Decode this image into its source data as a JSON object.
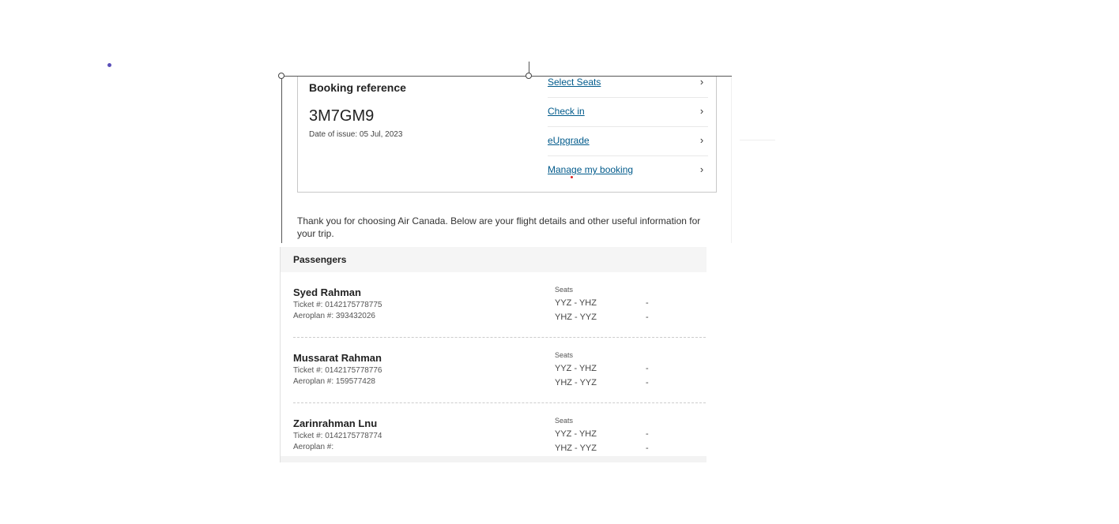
{
  "booking": {
    "label": "Booking reference",
    "code": "3M7GM9",
    "date_of_issue": "Date of issue: 05 Jul, 2023"
  },
  "links": [
    {
      "label": "Select Seats",
      "icon": "chevron-right-icon"
    },
    {
      "label": "Check in",
      "icon": "chevron-right-icon"
    },
    {
      "label": "eUpgrade",
      "icon": "chevron-right-icon"
    },
    {
      "label": "Manage my booking",
      "icon": "chevron-right-icon"
    }
  ],
  "intro_text": "Thank you for choosing Air Canada. Below are your flight details and other useful information for your trip.",
  "passengers_section": {
    "title": "Passengers",
    "seats_label": "Seats",
    "passengers": [
      {
        "name": "Syed Rahman",
        "ticket": "Ticket #: 0142175778775",
        "aeroplan": "Aeroplan #: 393432026",
        "seats": [
          {
            "route": "YYZ - YHZ",
            "seat": "-"
          },
          {
            "route": "YHZ - YYZ",
            "seat": "-"
          }
        ]
      },
      {
        "name": "Mussarat Rahman",
        "ticket": "Ticket #: 0142175778776",
        "aeroplan": "Aeroplan #: 159577428",
        "seats": [
          {
            "route": "YYZ - YHZ",
            "seat": "-"
          },
          {
            "route": "YHZ - YYZ",
            "seat": "-"
          }
        ]
      },
      {
        "name": "Zarinrahman Lnu",
        "ticket": "Ticket #: 0142175778774",
        "aeroplan": "Aeroplan #:",
        "seats": [
          {
            "route": "YYZ - YHZ",
            "seat": "-"
          },
          {
            "route": "YHZ - YYZ",
            "seat": "-"
          }
        ]
      }
    ]
  },
  "colors": {
    "link": "#005a8b",
    "accent_dot": "#5a4fb8"
  }
}
